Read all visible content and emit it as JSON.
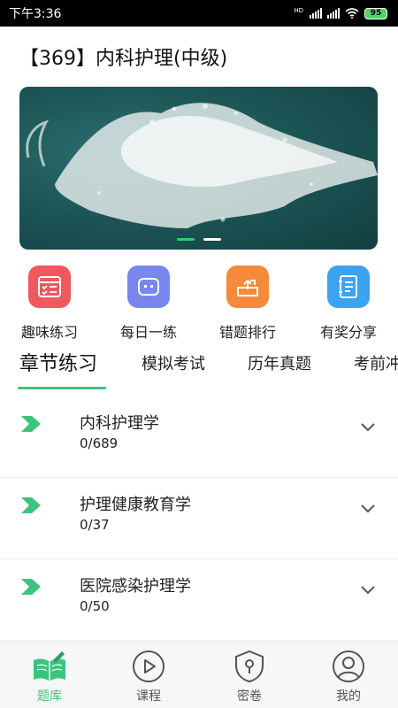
{
  "status_bar": {
    "time": "下午3:36",
    "network": "HD",
    "battery": "95"
  },
  "header": {
    "title": "【369】内科护理(中级)"
  },
  "banner": {
    "dots": [
      {
        "active": true
      },
      {
        "active": false
      }
    ]
  },
  "quick_actions": [
    {
      "label": "趣味练习",
      "icon": "checklist-icon",
      "color": "#f0575f"
    },
    {
      "label": "每日一练",
      "icon": "robot-icon",
      "color": "#7a86f0"
    },
    {
      "label": "错题排行",
      "icon": "share-box-icon",
      "color": "#f58a3c"
    },
    {
      "label": "有奖分享",
      "icon": "notebook-icon",
      "color": "#3aa3f2"
    }
  ],
  "tabs": [
    {
      "label": "章节练习",
      "active": true
    },
    {
      "label": "模拟考试",
      "active": false
    },
    {
      "label": "历年真题",
      "active": false
    },
    {
      "label": "考前冲",
      "active": false
    }
  ],
  "chapters": [
    {
      "name": "内科护理学",
      "progress": "0/689"
    },
    {
      "name": "护理健康教育学",
      "progress": "0/37"
    },
    {
      "name": "医院感染护理学",
      "progress": "0/50"
    }
  ],
  "bottom_nav": [
    {
      "label": "题库",
      "icon": "book-pen-icon",
      "active": true
    },
    {
      "label": "课程",
      "icon": "play-circle-icon",
      "active": false
    },
    {
      "label": "密卷",
      "icon": "shield-lock-icon",
      "active": false
    },
    {
      "label": "我的",
      "icon": "user-circle-icon",
      "active": false
    }
  ],
  "colors": {
    "accent": "#3cc47c",
    "text": "#222222"
  }
}
